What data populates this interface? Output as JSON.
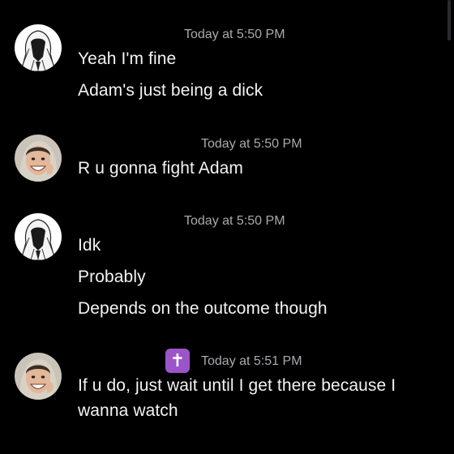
{
  "colors": {
    "background": "#000000",
    "timestamp": "#a9aab0",
    "message_text": "#f2f3f5",
    "badge": "#9c54c9"
  },
  "groups": [
    {
      "avatar": "hooded-figure-avatar",
      "timestamp": "Today at 5:50 PM",
      "messages": [
        "Yeah I'm fine",
        "Adam's just being a dick"
      ]
    },
    {
      "avatar": "smiling-man-avatar",
      "timestamp": "Today at 5:50 PM",
      "messages": [
        "R u gonna fight Adam"
      ]
    },
    {
      "avatar": "hooded-figure-avatar",
      "timestamp": "Today at 5:50 PM",
      "messages": [
        "Idk",
        "Probably",
        "Depends on the outcome though"
      ]
    },
    {
      "avatar": "smiling-man-avatar",
      "role_badge": "✝",
      "timestamp": "Today at 5:51 PM",
      "messages": [
        "If u do, just wait until I get there because I",
        "wanna watch"
      ]
    }
  ]
}
